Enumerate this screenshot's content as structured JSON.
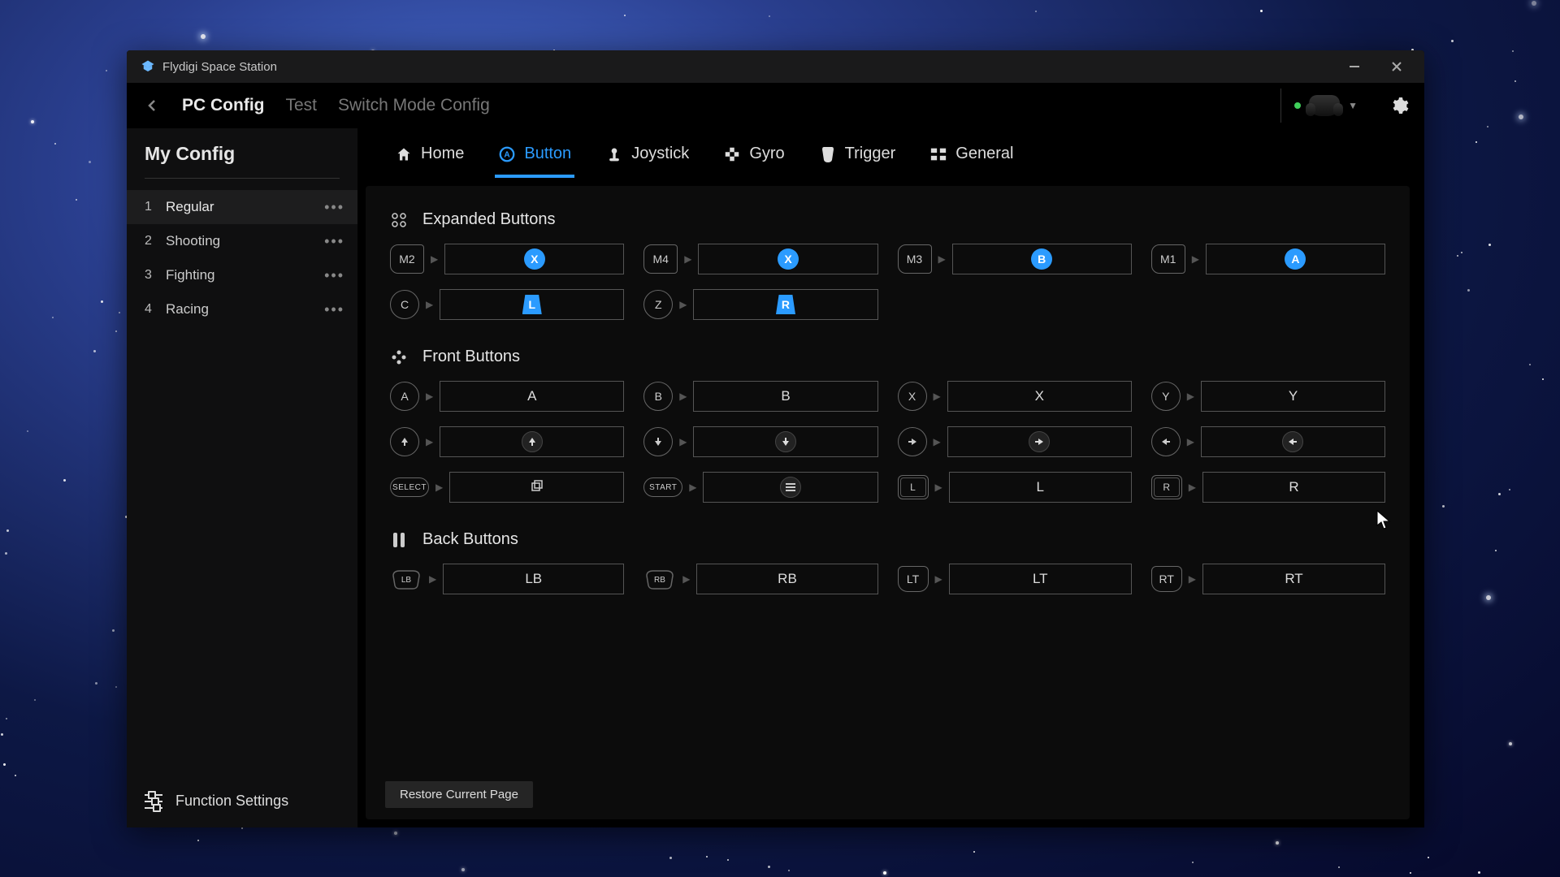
{
  "window": {
    "title": "Flydigi Space Station"
  },
  "breadcrumbs": {
    "items": [
      {
        "label": "PC Config",
        "active": true
      },
      {
        "label": "Test",
        "active": false
      },
      {
        "label": "Switch Mode Config",
        "active": false
      }
    ]
  },
  "device": {
    "status": "online"
  },
  "sidebar": {
    "title": "My Config",
    "configs": [
      {
        "num": "1",
        "name": "Regular",
        "active": true
      },
      {
        "num": "2",
        "name": "Shooting",
        "active": false
      },
      {
        "num": "3",
        "name": "Fighting",
        "active": false
      },
      {
        "num": "4",
        "name": "Racing",
        "active": false
      }
    ],
    "footer": "Function Settings"
  },
  "tabs": [
    {
      "label": "Home",
      "icon": "home",
      "active": false
    },
    {
      "label": "Button",
      "icon": "button",
      "active": true
    },
    {
      "label": "Joystick",
      "icon": "joystick",
      "active": false
    },
    {
      "label": "Gyro",
      "icon": "gyro",
      "active": false
    },
    {
      "label": "Trigger",
      "icon": "trigger",
      "active": false
    },
    {
      "label": "General",
      "icon": "general",
      "active": false
    }
  ],
  "sections": [
    {
      "title": "Expanded Buttons",
      "icon": "grid4",
      "rows": [
        [
          {
            "hw": "M2",
            "hwShape": "shape-m",
            "val": "X",
            "style": "blue-circle"
          },
          {
            "hw": "M4",
            "hwShape": "shape-m",
            "val": "X",
            "style": "blue-circle"
          },
          {
            "hw": "M3",
            "hwShape": "shape-m",
            "val": "B",
            "style": "blue-circle"
          },
          {
            "hw": "M1",
            "hwShape": "shape-m",
            "val": "A",
            "style": "blue-circle"
          }
        ],
        [
          {
            "hw": "C",
            "hwShape": "",
            "val": "L",
            "style": "blue-trap"
          },
          {
            "hw": "Z",
            "hwShape": "",
            "val": "R",
            "style": "blue-trap"
          }
        ]
      ]
    },
    {
      "title": "Front Buttons",
      "icon": "dpad",
      "rows": [
        [
          {
            "hw": "A",
            "hwShape": "",
            "val": "A",
            "style": "text"
          },
          {
            "hw": "B",
            "hwShape": "",
            "val": "B",
            "style": "text"
          },
          {
            "hw": "X",
            "hwShape": "",
            "val": "X",
            "style": "text"
          },
          {
            "hw": "Y",
            "hwShape": "",
            "val": "Y",
            "style": "text"
          }
        ],
        [
          {
            "hw": "↑",
            "hwShape": "",
            "val": "↑",
            "style": "arrow-circle",
            "arrow": "up"
          },
          {
            "hw": "↓",
            "hwShape": "",
            "val": "↓",
            "style": "arrow-circle",
            "arrow": "down"
          },
          {
            "hw": "→",
            "hwShape": "",
            "val": "→",
            "style": "arrow-circle",
            "arrow": "right"
          },
          {
            "hw": "←",
            "hwShape": "",
            "val": "←",
            "style": "arrow-circle",
            "arrow": "left"
          }
        ],
        [
          {
            "hw": "SELECT",
            "hwShape": "shape-pill",
            "val": "⧉",
            "style": "icon"
          },
          {
            "hw": "START",
            "hwShape": "shape-pill",
            "val": "≡",
            "style": "icon"
          },
          {
            "hw": "L",
            "hwShape": "shape-trap2",
            "val": "L",
            "style": "text"
          },
          {
            "hw": "R",
            "hwShape": "shape-trap2",
            "val": "R",
            "style": "text"
          }
        ]
      ]
    },
    {
      "title": "Back Buttons",
      "icon": "back-btn",
      "rows": [
        [
          {
            "hw": "LB",
            "hwShape": "shape-trap3",
            "val": "LB",
            "style": "text"
          },
          {
            "hw": "RB",
            "hwShape": "shape-trap3",
            "val": "RB",
            "style": "text"
          },
          {
            "hw": "LT",
            "hwShape": "shape-trap",
            "val": "LT",
            "style": "text"
          },
          {
            "hw": "RT",
            "hwShape": "shape-trap",
            "val": "RT",
            "style": "text"
          }
        ]
      ]
    }
  ],
  "footer": {
    "restore": "Restore Current Page"
  }
}
